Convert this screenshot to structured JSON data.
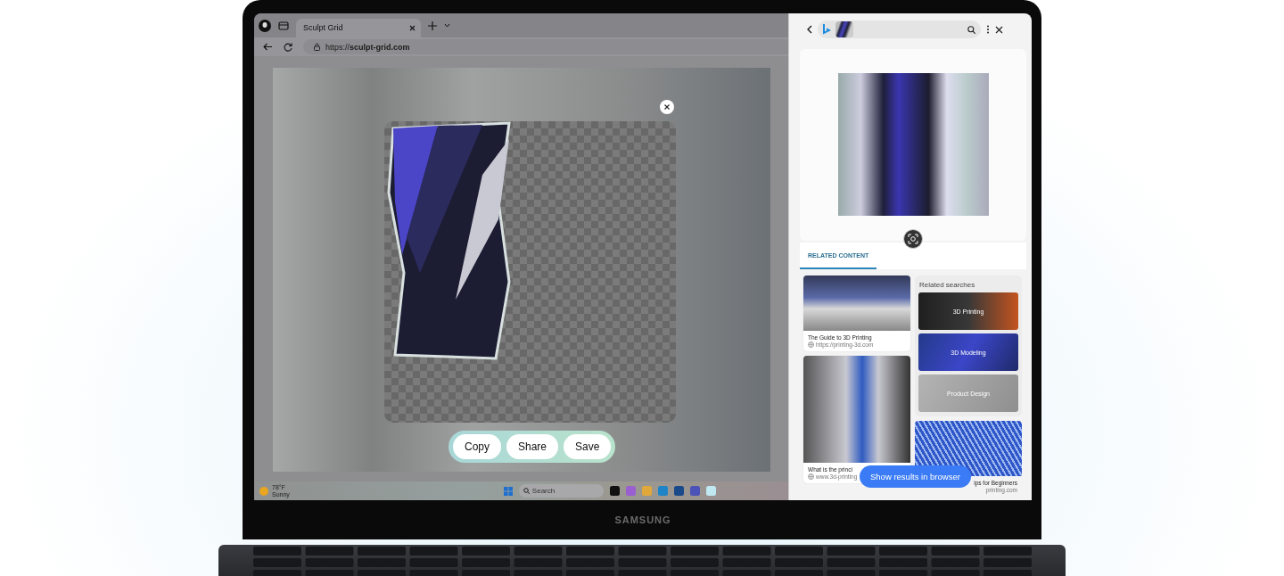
{
  "browser": {
    "tabs": [
      {
        "label": "Sculpt Grid",
        "selected": true
      }
    ],
    "url": "https://**sculpt-grid.com**"
  },
  "image_overlay": {
    "actions": [
      "Copy",
      "Share",
      "Save"
    ]
  },
  "taskbar": {
    "weather": {
      "temperature": "78°F",
      "condition": "Sunny"
    },
    "search": {
      "placeholder": "Search"
    }
  },
  "side_panel": {
    "tabs": [
      {
        "label": "RELATED CONTENT",
        "selected": true
      }
    ],
    "results": [
      {
        "title": "The Guide to 3D Printing",
        "source": "https://printing-3d.com"
      },
      {
        "title": "What is the princi",
        "source": "www.3d-printing"
      }
    ],
    "related_searches": {
      "heading": "Related searches",
      "items": [
        "3D Printing",
        "3D Modeling",
        "Product Design"
      ]
    },
    "result_right": {
      "title": "ips for Beginners",
      "source": "printing.com"
    },
    "show_results_button": "Show results in browser"
  },
  "device": {
    "brand": "SAMSUNG"
  }
}
